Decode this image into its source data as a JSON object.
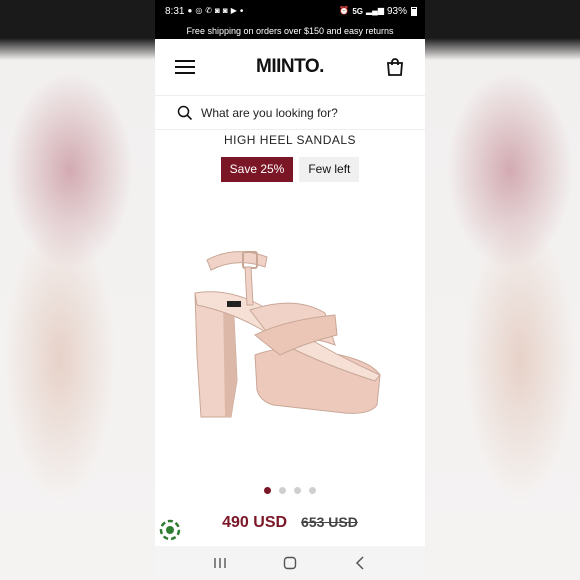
{
  "status_bar": {
    "time": "8:31",
    "dot": "•",
    "network": "5G",
    "battery": "93%",
    "left_icons": [
      "chat-icon",
      "messenger-icon",
      "phone-icon",
      "instagram-icon",
      "instagram-icon",
      "youtube-icon"
    ]
  },
  "promo": {
    "text": "Free shipping on orders over $150 and easy returns"
  },
  "header": {
    "logo": "MIINTO."
  },
  "search": {
    "placeholder": "What are you looking for?"
  },
  "product": {
    "name": "HIGH HEEL SANDALS",
    "badge_save": "Save 25%",
    "badge_stock": "Few left",
    "price_current": "490 USD",
    "price_original": "653 USD",
    "image_count": 4,
    "active_image": 0
  },
  "colors": {
    "brand": "#7a1626",
    "sandal": "#f0d3c6"
  }
}
